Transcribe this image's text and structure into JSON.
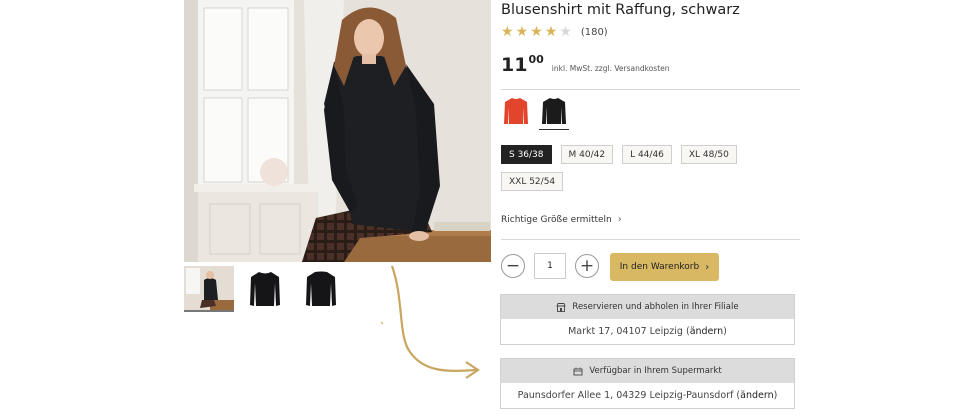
{
  "product": {
    "title": "Blusenshirt mit Raffung, schwarz",
    "rating": {
      "stars": 4,
      "max": 5,
      "count": "(180)"
    },
    "price": {
      "main": "11",
      "cents": "00",
      "note": "inkl. MwSt. zzgl. Versandkosten"
    }
  },
  "colors": [
    {
      "name": "red-top",
      "hex": "#e2442c",
      "selected": false
    },
    {
      "name": "black-top",
      "hex": "#1b1b1b",
      "selected": true
    }
  ],
  "sizes": [
    {
      "label": "S 36/38",
      "active": true
    },
    {
      "label": "M 40/42",
      "active": false
    },
    {
      "label": "L 44/46",
      "active": false
    },
    {
      "label": "XL 48/50",
      "active": false
    },
    {
      "label": "XXL 52/54",
      "active": false
    }
  ],
  "size_guide": "Richtige Größe ermitteln",
  "quantity": {
    "value": "1",
    "minus": "−",
    "plus": "+"
  },
  "cart_button": "In den Warenkorb",
  "reserve": {
    "heading": "Reservieren und abholen in Ihrer Filiale",
    "address": "Markt 17, 04107 Leipzig",
    "open": "(",
    "change": "ändern",
    "close": ")"
  },
  "supermarket": {
    "heading": "Verfügbar in Ihrem Supermarkt",
    "address": "Paunsdorfer Allee 1, 04329 Leipzig-Paunsdorf",
    "open": "(",
    "change": "ändern",
    "close": ")"
  },
  "icons": {
    "chevron": "›",
    "store": "store-icon",
    "cart": "shopping-basket-icon",
    "star": "★"
  },
  "colors_ui": {
    "accent": "#d8b862",
    "star": "#d9b45a",
    "star_empty": "#d8d8d8",
    "arrow": "#c9a660"
  }
}
